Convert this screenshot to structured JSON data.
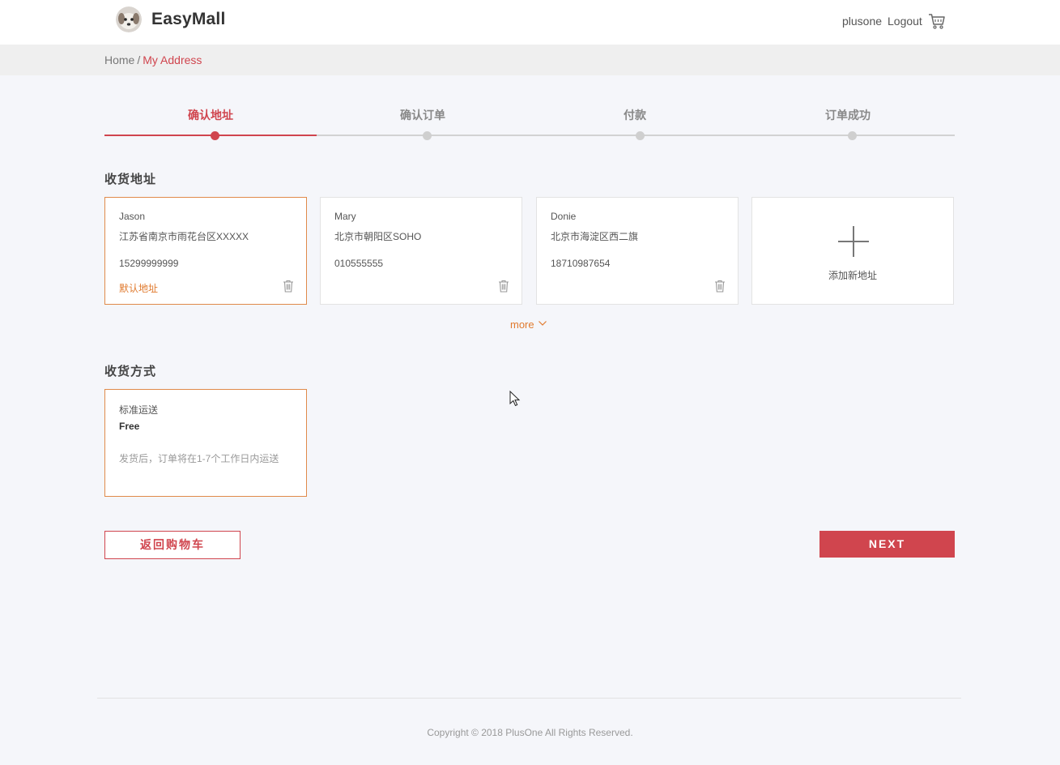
{
  "header": {
    "brand": "EasyMall",
    "user": "plusone",
    "logout": "Logout"
  },
  "breadcrumb": {
    "home": "Home",
    "separator": "/",
    "current": "My Address"
  },
  "steps": [
    {
      "label": "确认地址",
      "active": true
    },
    {
      "label": "确认订单",
      "active": false
    },
    {
      "label": "付款",
      "active": false
    },
    {
      "label": "订单成功",
      "active": false
    }
  ],
  "address_section": {
    "title": "收货地址",
    "cards": [
      {
        "name": "Jason",
        "address": "江苏省南京市雨花台区XXXXX",
        "phone": "15299999999",
        "default_label": "默认地址",
        "selected": true
      },
      {
        "name": "Mary",
        "address": "北京市朝阳区SOHO",
        "phone": "010555555",
        "default_label": "",
        "selected": false
      },
      {
        "name": "Donie",
        "address": "北京市海淀区西二旗",
        "phone": "18710987654",
        "default_label": "",
        "selected": false
      }
    ],
    "add_label": "添加新地址",
    "more_label": "more"
  },
  "shipping_section": {
    "title": "收货方式",
    "option": {
      "name": "标准运送",
      "price": "Free",
      "description": "发货后，订单将在1-7个工作日内运送"
    }
  },
  "actions": {
    "back_label": "返回购物车",
    "next_label": "NEXT"
  },
  "footer": {
    "copyright": "Copyright © 2018 PlusOne All Rights Reserved."
  },
  "colors": {
    "accent": "#d0454e",
    "highlight": "#e07a2e",
    "background": "#f5f6fa"
  }
}
